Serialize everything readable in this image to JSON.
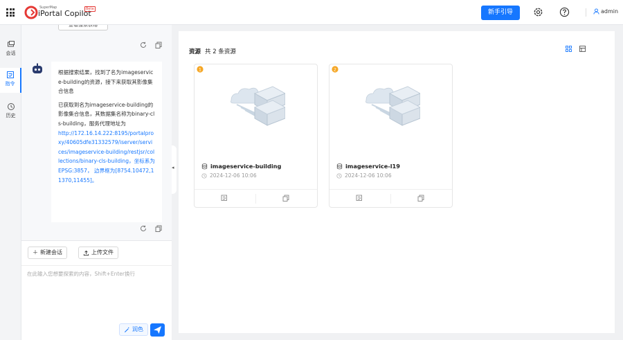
{
  "header": {
    "brand_small": "SuperMap",
    "brand_title": "iPortal Copilot",
    "brand_badge": "Beta",
    "guide_button": "新手引导",
    "username": "admin"
  },
  "leftnav": {
    "items": [
      {
        "label": "会话",
        "icon": "chat-icon"
      },
      {
        "label": "指令",
        "icon": "command-icon"
      },
      {
        "label": "历史",
        "icon": "history-icon"
      }
    ],
    "active_index": 1
  },
  "chat": {
    "previous_button": "查看搜索表格",
    "message": {
      "paragraph1": "根据搜索结果，找到了名为imageservice-building的资源，接下来获取其影像集合信息",
      "paragraph2_text": "已获取到名为imageservice-building的影像集合信息，其数据集名称为binary-cls-building，服务代理地址为",
      "paragraph2_link": "http://172.16.14.222:8195/portalproxy/40605dfe31332579/iserver/services/imageservice-building/restjsr/collections/binary-cls-building，坐标系为EPSG:3857，",
      "paragraph2_tail": "边界框为[8754.10472,11370,11455]。"
    },
    "composer": {
      "new_chat_label": "新建会话",
      "upload_label": "上传文件",
      "placeholder": "在此输入您想要探索的内容，Shift+Enter换行",
      "polish_label": "润色"
    }
  },
  "main": {
    "title": "资源",
    "count_text": "共 2 条资源",
    "cards": [
      {
        "rank": "1",
        "name": "imageservice-building",
        "time": "2024-12-06 10:06",
        "badge_color": "#f5a623"
      },
      {
        "rank": "2",
        "name": "imageservice-l19",
        "time": "2024-12-06 10:06",
        "badge_color": "#f5a623"
      }
    ]
  },
  "colors": {
    "accent": "#1677ff",
    "logo_red": "#e53935"
  }
}
